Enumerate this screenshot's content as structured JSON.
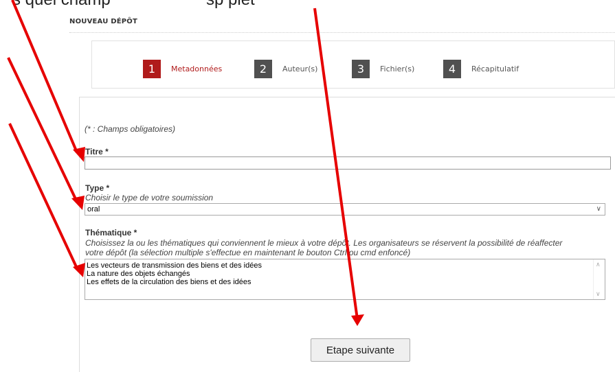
{
  "top_text": {
    "left": "s quel    champ",
    "right": "sp     plet"
  },
  "section_title": "NOUVEAU DÉPÔT",
  "steps": [
    {
      "num": "1",
      "label": "Metadonnées",
      "active": true
    },
    {
      "num": "2",
      "label": "Auteur(s)",
      "active": false
    },
    {
      "num": "3",
      "label": "Fichier(s)",
      "active": false
    },
    {
      "num": "4",
      "label": "Récapitulatif",
      "active": false
    }
  ],
  "form": {
    "help_text": "(* : Champs obligatoires)",
    "titre_label": "Titre *",
    "titre_value": "",
    "type_label": "Type *",
    "type_help": "Choisir le type de votre soumission",
    "type_value": "oral",
    "thematique_label": "Thématique *",
    "thematique_help": "Choisissez la ou les thématiques qui conviennent le mieux à votre dépôt. Les organisateurs se réservent la possibilité de réaffecter votre dépôt (la sélection multiple s'effectue en maintenant le bouton Ctrl ou cmd enfoncé)",
    "thematique_options": [
      "Les vecteurs de transmission des biens et des idées",
      "La nature des objets échangés",
      "Les effets de la circulation des biens et des idées"
    ],
    "next_button": "Etape suivante"
  },
  "colors": {
    "accent": "#b01b1b",
    "step_inactive": "#505050",
    "arrow": "#e60000"
  },
  "icons": {
    "select_chevron": "chevron-down-icon",
    "scroll_up": "scroll-up-icon",
    "scroll_down": "scroll-down-icon"
  }
}
